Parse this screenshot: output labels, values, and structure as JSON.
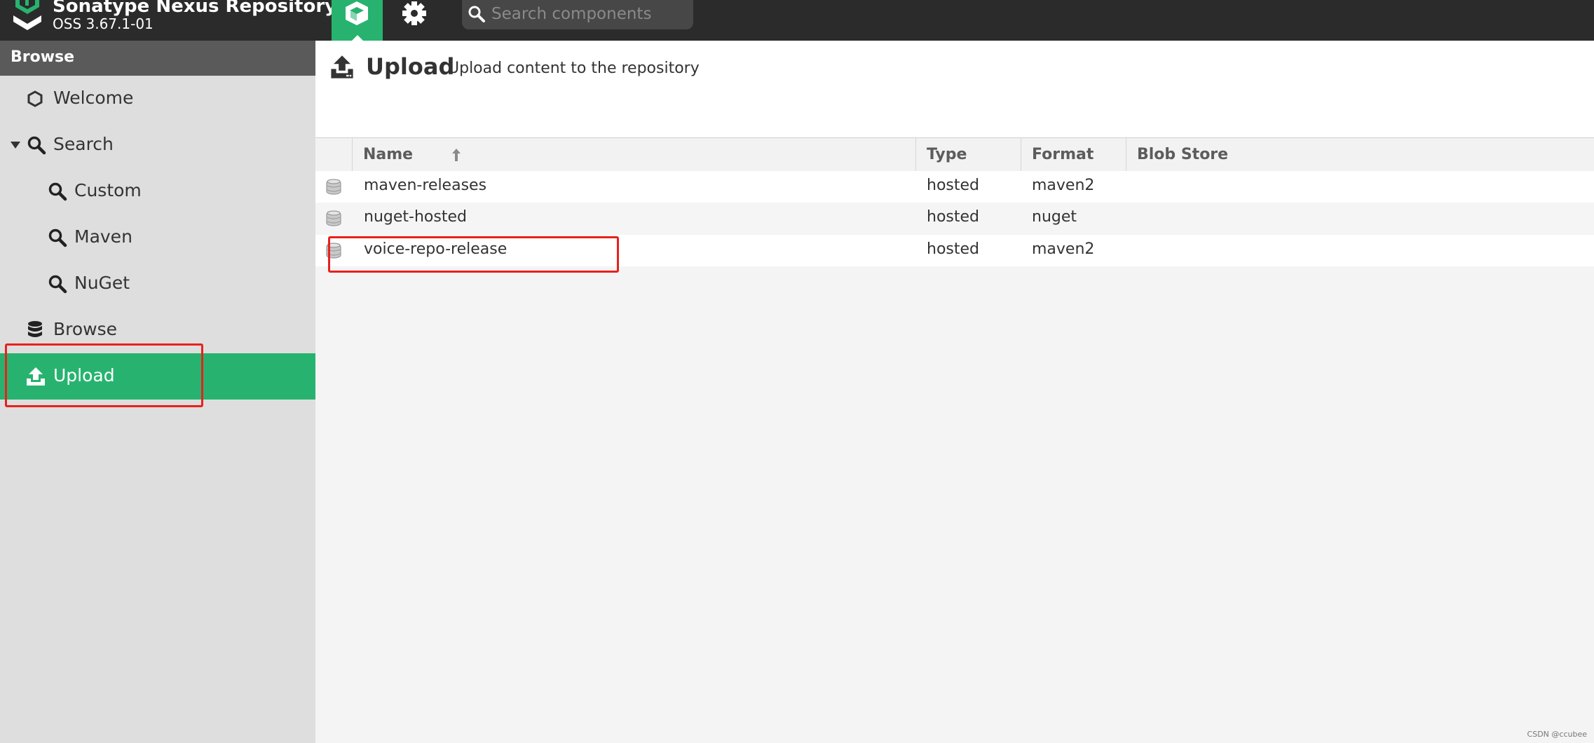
{
  "app": {
    "title": "Sonatype Nexus Repository",
    "version": "OSS 3.67.1-01"
  },
  "toolbar": {
    "browse_mode_icon": "cube-icon",
    "admin_mode_icon": "gear-icon",
    "search": {
      "placeholder": "Search components",
      "value": ""
    }
  },
  "sidebar": {
    "header": "Browse",
    "items": [
      {
        "label": "Welcome",
        "icon": "hexagon-icon"
      },
      {
        "label": "Search",
        "icon": "search-icon",
        "expanded": true
      },
      {
        "label": "Custom",
        "icon": "search-icon"
      },
      {
        "label": "Maven",
        "icon": "search-icon"
      },
      {
        "label": "NuGet",
        "icon": "search-icon"
      },
      {
        "label": "Browse",
        "icon": "database-icon"
      },
      {
        "label": "Upload",
        "icon": "upload-icon",
        "selected": true
      }
    ]
  },
  "page": {
    "title": "Upload",
    "subtitle": "Upload content to the repository"
  },
  "grid": {
    "columns": [
      "Name",
      "Type",
      "Format",
      "Blob Store"
    ],
    "sort": {
      "column": "Name",
      "direction": "asc"
    },
    "rows": [
      {
        "name": "maven-releases",
        "type": "hosted",
        "format": "maven2",
        "blob_store": ""
      },
      {
        "name": "nuget-hosted",
        "type": "hosted",
        "format": "nuget",
        "blob_store": ""
      },
      {
        "name": "voice-repo-release",
        "type": "hosted",
        "format": "maven2",
        "blob_store": ""
      }
    ]
  },
  "colors": {
    "accent": "#27b36f",
    "topbar": "#2b2b2b",
    "sidebar": "#dedede",
    "annotation": "#e8211c"
  },
  "watermark": "CSDN @ccubee"
}
